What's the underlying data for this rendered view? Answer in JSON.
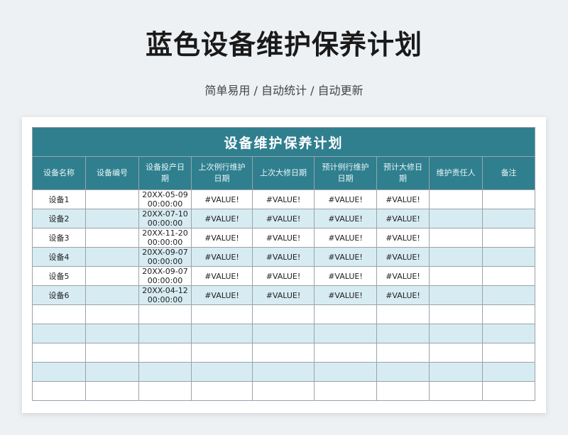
{
  "title": "蓝色设备维护保养计划",
  "subtitle": "简单易用 / 自动统计 / 自动更新",
  "sheet": {
    "banner": "设备维护保养计划",
    "headers": [
      "设备名称",
      "设备编号",
      "设备投产日期",
      "上次例行维护日期",
      "上次大修日期",
      "预计例行维护日期",
      "预计大修日期",
      "维护责任人",
      "备注"
    ],
    "rows": [
      [
        "设备1",
        "",
        "20XX-05-09 00:00:00",
        "#VALUE!",
        "#VALUE!",
        "#VALUE!",
        "#VALUE!",
        "",
        ""
      ],
      [
        "设备2",
        "",
        "20XX-07-10 00:00:00",
        "#VALUE!",
        "#VALUE!",
        "#VALUE!",
        "#VALUE!",
        "",
        ""
      ],
      [
        "设备3",
        "",
        "20XX-11-20 00:00:00",
        "#VALUE!",
        "#VALUE!",
        "#VALUE!",
        "#VALUE!",
        "",
        ""
      ],
      [
        "设备4",
        "",
        "20XX-09-07 00:00:00",
        "#VALUE!",
        "#VALUE!",
        "#VALUE!",
        "#VALUE!",
        "",
        ""
      ],
      [
        "设备5",
        "",
        "20XX-09-07 00:00:00",
        "#VALUE!",
        "#VALUE!",
        "#VALUE!",
        "#VALUE!",
        "",
        ""
      ],
      [
        "设备6",
        "",
        "20XX-04-12 00:00:00",
        "#VALUE!",
        "#VALUE!",
        "#VALUE!",
        "#VALUE!",
        "",
        ""
      ],
      [
        "",
        "",
        "",
        "",
        "",
        "",
        "",
        "",
        ""
      ],
      [
        "",
        "",
        "",
        "",
        "",
        "",
        "",
        "",
        ""
      ],
      [
        "",
        "",
        "",
        "",
        "",
        "",
        "",
        "",
        ""
      ],
      [
        "",
        "",
        "",
        "",
        "",
        "",
        "",
        "",
        ""
      ],
      [
        "",
        "",
        "",
        "",
        "",
        "",
        "",
        "",
        ""
      ]
    ]
  },
  "colors": {
    "header_bg": "#2f7f8f",
    "alt_row": "#d7ebf2",
    "header_text": "#ffffff"
  }
}
